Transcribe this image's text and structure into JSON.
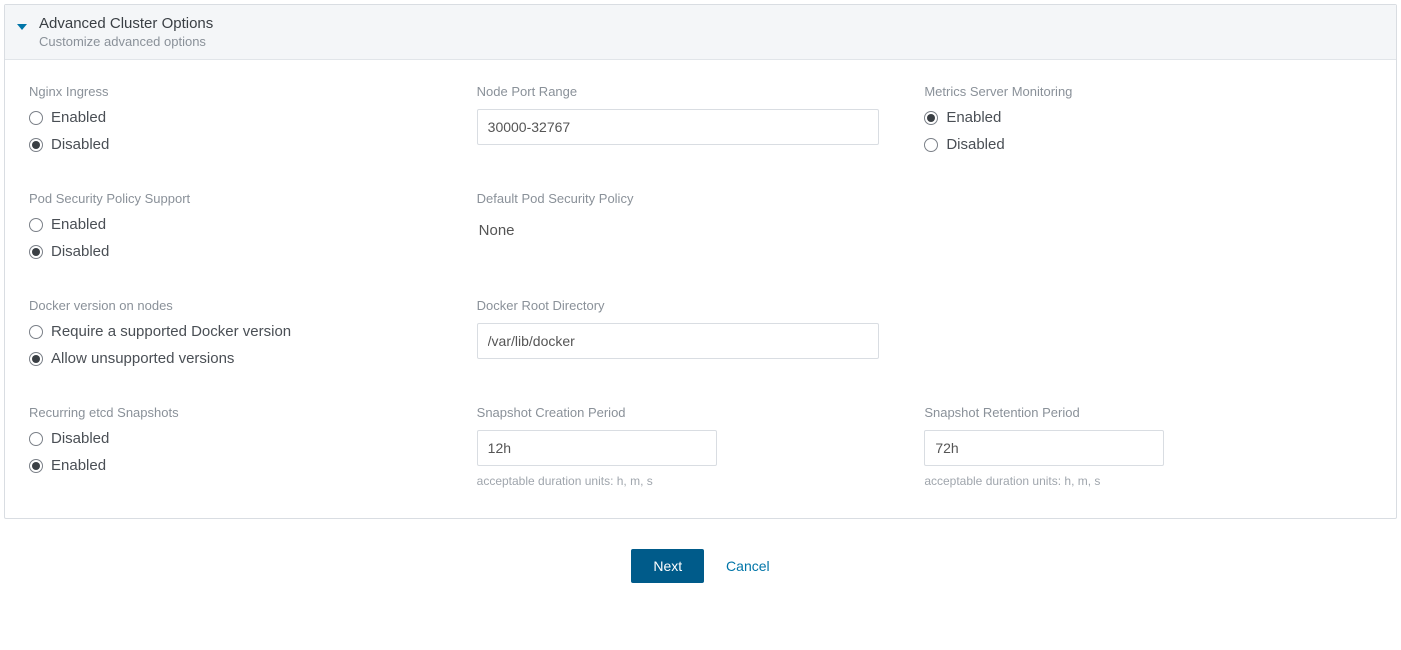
{
  "panel": {
    "title": "Advanced Cluster Options",
    "subtitle": "Customize advanced options"
  },
  "nginx_ingress": {
    "label": "Nginx Ingress",
    "enabled": "Enabled",
    "disabled": "Disabled",
    "selected": "disabled"
  },
  "node_port_range": {
    "label": "Node Port Range",
    "value": "30000-32767"
  },
  "metrics_server": {
    "label": "Metrics Server Monitoring",
    "enabled": "Enabled",
    "disabled": "Disabled",
    "selected": "enabled"
  },
  "pod_security_support": {
    "label": "Pod Security Policy Support",
    "enabled": "Enabled",
    "disabled": "Disabled",
    "selected": "disabled"
  },
  "default_pod_security": {
    "label": "Default Pod Security Policy",
    "value": "None"
  },
  "docker_version": {
    "label": "Docker version on nodes",
    "require": "Require a supported Docker version",
    "allow": "Allow unsupported versions",
    "selected": "allow"
  },
  "docker_root": {
    "label": "Docker Root Directory",
    "value": "/var/lib/docker"
  },
  "etcd_snapshots": {
    "label": "Recurring etcd Snapshots",
    "disabled": "Disabled",
    "enabled": "Enabled",
    "selected": "enabled"
  },
  "snapshot_creation": {
    "label": "Snapshot Creation Period",
    "value": "12h",
    "hint": "acceptable duration units: h, m, s"
  },
  "snapshot_retention": {
    "label": "Snapshot Retention Period",
    "value": "72h",
    "hint": "acceptable duration units: h, m, s"
  },
  "footer": {
    "next": "Next",
    "cancel": "Cancel"
  }
}
